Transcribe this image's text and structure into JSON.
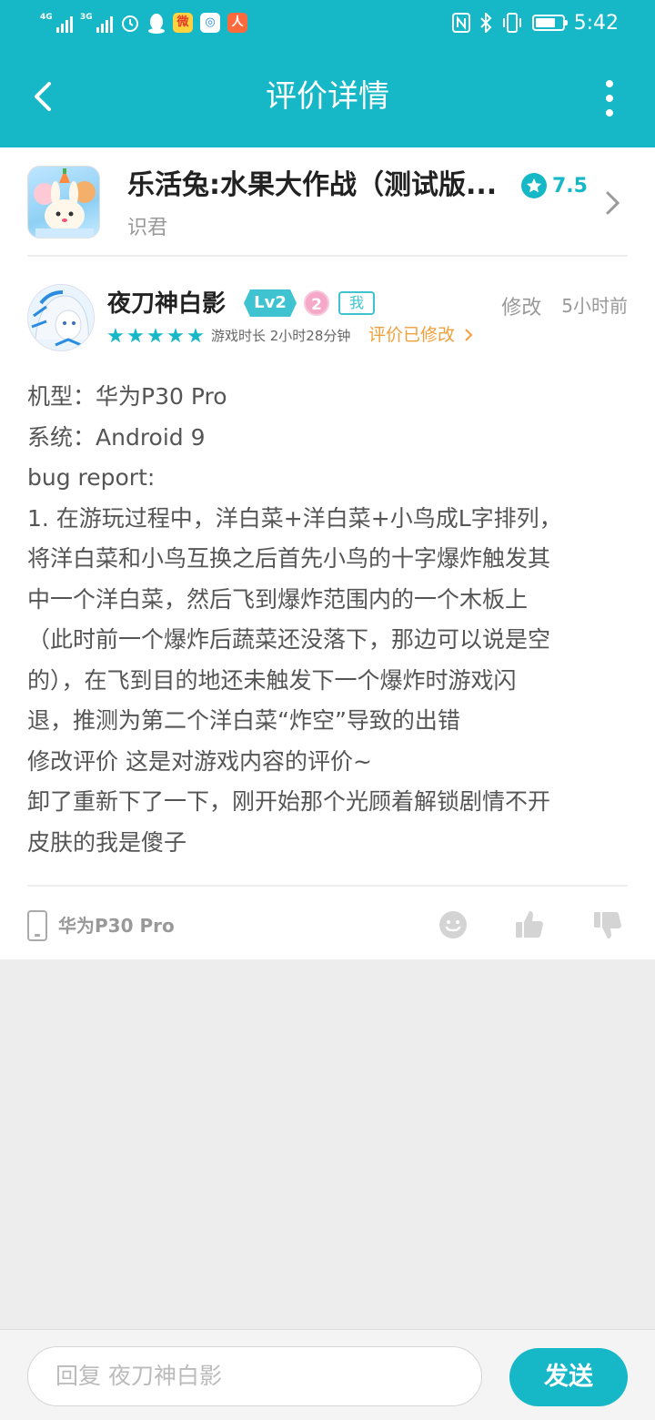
{
  "status_bar": {
    "signal1_type": "4G",
    "signal2_type": "3G",
    "time": "5:42",
    "battery_percent": 75,
    "notification_icons": [
      "alarm-icon",
      "qq-penguin-icon",
      "weibo-icon",
      "browser-icon",
      "app-icon"
    ],
    "system_icons": [
      "nfc-icon",
      "bluetooth-icon",
      "vibrate-icon",
      "battery-icon"
    ]
  },
  "header": {
    "title": "评价详情",
    "back_icon": "chevron-left-icon",
    "more_icon": "more-vertical-icon"
  },
  "game": {
    "name": "乐活兔:水果大作战（测试版...",
    "developer": "识君",
    "rating": "7.5"
  },
  "review": {
    "username": "夜刀神白影",
    "level": "Lv2",
    "medal": "2",
    "me_tag": "我",
    "edit_label": "修改",
    "time_ago": "5小时前",
    "star_count": 5,
    "playtime": "游戏时长 2小时28分钟",
    "modified_label": "评价已修改",
    "lines": [
      "机型：华为P30 Pro",
      "系统：Android 9",
      "bug report:",
      "1. 在游玩过程中，洋白菜+洋白菜+小鸟成L字排列，",
      "将洋白菜和小鸟互换之后首先小鸟的十字爆炸触发其",
      "中一个洋白菜，然后飞到爆炸范围内的一个木板上",
      "（此时前一个爆炸后蔬菜还没落下，那边可以说是空",
      "的），在飞到目的地还未触发下一个爆炸时游戏闪",
      "退，推测为第二个洋白菜“炸空”导致的出错",
      "修改评价 这是对游戏内容的评价~",
      "卸了重新下了一下，刚开始那个光顾着解锁剧情不开",
      "皮肤的我是傻子"
    ],
    "device": "华为P30 Pro"
  },
  "reply": {
    "placeholder": "回复 夜刀神白影",
    "send_label": "发送"
  },
  "colors": {
    "primary": "#16b8c8",
    "modified": "#f0a03a",
    "background": "#ededed"
  }
}
